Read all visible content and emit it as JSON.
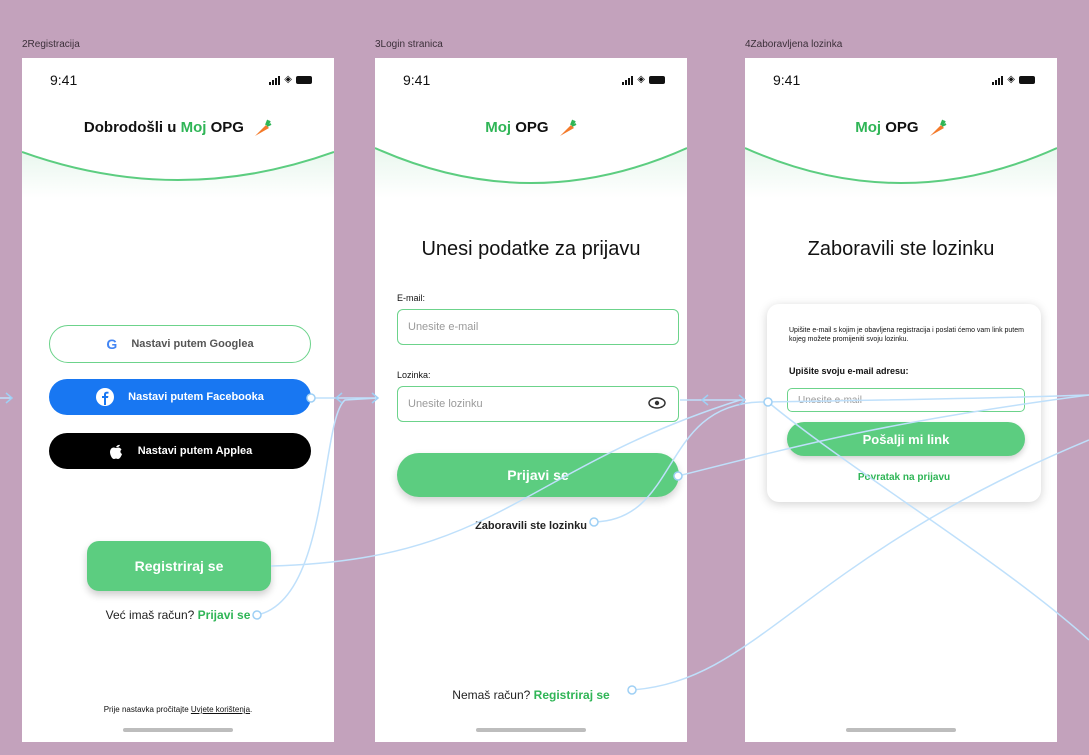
{
  "frames": {
    "f1": "2Registracija",
    "f2": "3Login stranica",
    "f3": "4Zaboravljena lozinka"
  },
  "status": {
    "time": "9:41"
  },
  "brand": {
    "moj": "Moj",
    "opg": "OPG"
  },
  "registration": {
    "welcome_prefix": "Dobrodošli u",
    "google_label": "Nastavi putem Googlea",
    "facebook_label": "Nastavi putem Facebooka",
    "apple_label": "Nastavi putem Applea",
    "register_button": "Registriraj se",
    "have_account": "Već imaš račun?",
    "login_link": "Prijavi se",
    "terms_prefix": "Prije nastavka pročitajte",
    "terms_link": "Uvjete korištenja",
    "terms_suffix": "."
  },
  "login": {
    "title": "Unesi podatke za prijavu",
    "email_label": "E-mail:",
    "email_placeholder": "Unesite e-mail",
    "password_label": "Lozinka:",
    "password_placeholder": "Unesite lozinku",
    "login_button": "Prijavi se",
    "forgot_link": "Zaboravili ste lozinku",
    "no_account": "Nemaš račun?",
    "register_link": "Registriraj se"
  },
  "forgot": {
    "title": "Zaboravili ste lozinku",
    "description": "Upišite e-mail s kojim je obavljena registracija i poslati ćemo vam link putem kojeg možete promijeniti svoju lozinku.",
    "email_label": "Upišite svoju e-mail adresu:",
    "email_placeholder": "Unesite e-mail",
    "send_button": "Pošalji mi link",
    "back_link": "Povratak na prijavu"
  },
  "colors": {
    "canvas": "#c3a2bc",
    "accent": "#5ccd80",
    "brand_green": "#2fb556",
    "facebook": "#1877f2",
    "wire": "#bfe0fb"
  },
  "icons": [
    "google-icon",
    "facebook-icon",
    "apple-icon",
    "eye-icon",
    "carrot-icon",
    "signal-icon",
    "wifi-icon",
    "battery-icon"
  ]
}
